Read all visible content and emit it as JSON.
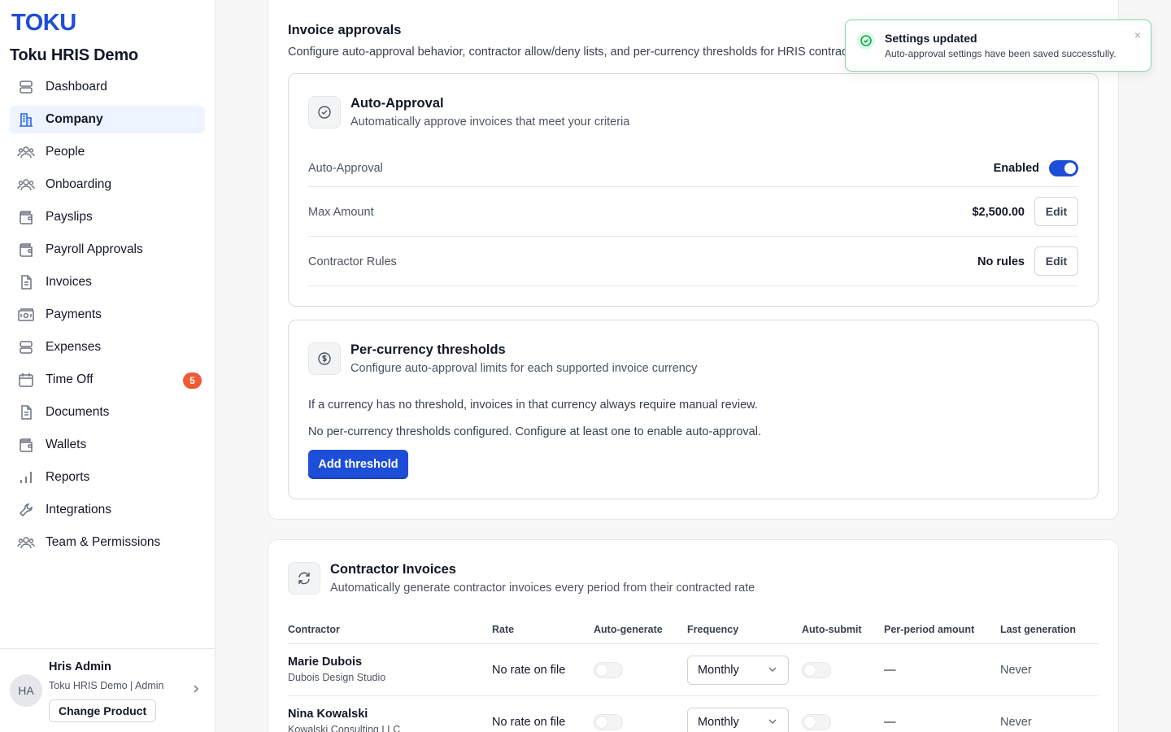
{
  "app": {
    "logo_text": "TOKU",
    "org_name": "Toku HRIS Demo"
  },
  "sidebar": {
    "items": [
      {
        "label": "Dashboard",
        "icon": "dashboard-icon"
      },
      {
        "label": "Company",
        "icon": "building-icon",
        "active": true
      },
      {
        "label": "People",
        "icon": "users-icon"
      },
      {
        "label": "Onboarding",
        "icon": "users-icon"
      },
      {
        "label": "Payslips",
        "icon": "wallet-icon"
      },
      {
        "label": "Payroll Approvals",
        "icon": "wallet-icon"
      },
      {
        "label": "Invoices",
        "icon": "document-icon"
      },
      {
        "label": "Payments",
        "icon": "money-icon"
      },
      {
        "label": "Expenses",
        "icon": "stack-icon"
      },
      {
        "label": "Time Off",
        "icon": "calendar-icon",
        "badge": "5"
      },
      {
        "label": "Documents",
        "icon": "document-icon"
      },
      {
        "label": "Wallets",
        "icon": "wallet-icon"
      },
      {
        "label": "Reports",
        "icon": "bar-chart-icon"
      },
      {
        "label": "Integrations",
        "icon": "wrench-icon"
      },
      {
        "label": "Team & Permissions",
        "icon": "users-icon"
      }
    ],
    "badge_color": "#ef5a34",
    "footer": {
      "avatar_initials": "HA",
      "user_name": "Hris Admin",
      "user_meta": "Toku HRIS Demo | Admin",
      "change_product_label": "Change Product"
    }
  },
  "invoice_approvals": {
    "title": "Invoice approvals",
    "description": "Configure auto-approval behavior, contractor allow/deny lists, and per-currency thresholds for HRIS contractor invoices."
  },
  "auto_approval": {
    "title": "Auto-Approval",
    "subtitle": "Automatically approve invoices that meet your criteria",
    "rows": {
      "auto_approval_label": "Auto-Approval",
      "auto_approval_status": "Enabled",
      "auto_approval_on": true,
      "max_amount_label": "Max Amount",
      "max_amount_value": "$2,500.00",
      "contractor_rules_label": "Contractor Rules",
      "contractor_rules_value": "No rules",
      "edit_label": "Edit"
    }
  },
  "thresholds": {
    "title": "Per-currency thresholds",
    "subtitle": "Configure auto-approval limits for each supported invoice currency",
    "note": "If a currency has no threshold, invoices in that currency always require manual review.",
    "empty_message": "No per-currency thresholds configured. Configure at least one to enable auto-approval.",
    "add_button": "Add threshold"
  },
  "contractor_invoices": {
    "title": "Contractor Invoices",
    "subtitle": "Automatically generate contractor invoices every period from their contracted rate",
    "columns": [
      "Contractor",
      "Rate",
      "Auto-generate",
      "Frequency",
      "Auto-submit",
      "Per-period amount",
      "Last generation"
    ],
    "rows": [
      {
        "name": "Marie Dubois",
        "company": "Dubois Design Studio",
        "rate": "No rate on file",
        "auto_generate": false,
        "frequency": "Monthly",
        "auto_submit": false,
        "amount": "—",
        "last_generation": "Never"
      },
      {
        "name": "Nina Kowalski",
        "company": "Kowalski Consulting LLC",
        "rate": "No rate on file",
        "auto_generate": false,
        "frequency": "Monthly",
        "auto_submit": false,
        "amount": "—",
        "last_generation": "Never"
      }
    ]
  },
  "toast": {
    "title": "Settings updated",
    "message": "Auto-approval settings have been saved successfully.",
    "close_glyph": "×"
  },
  "colors": {
    "accent": "#1d4ed8",
    "success": "#16a34a"
  }
}
